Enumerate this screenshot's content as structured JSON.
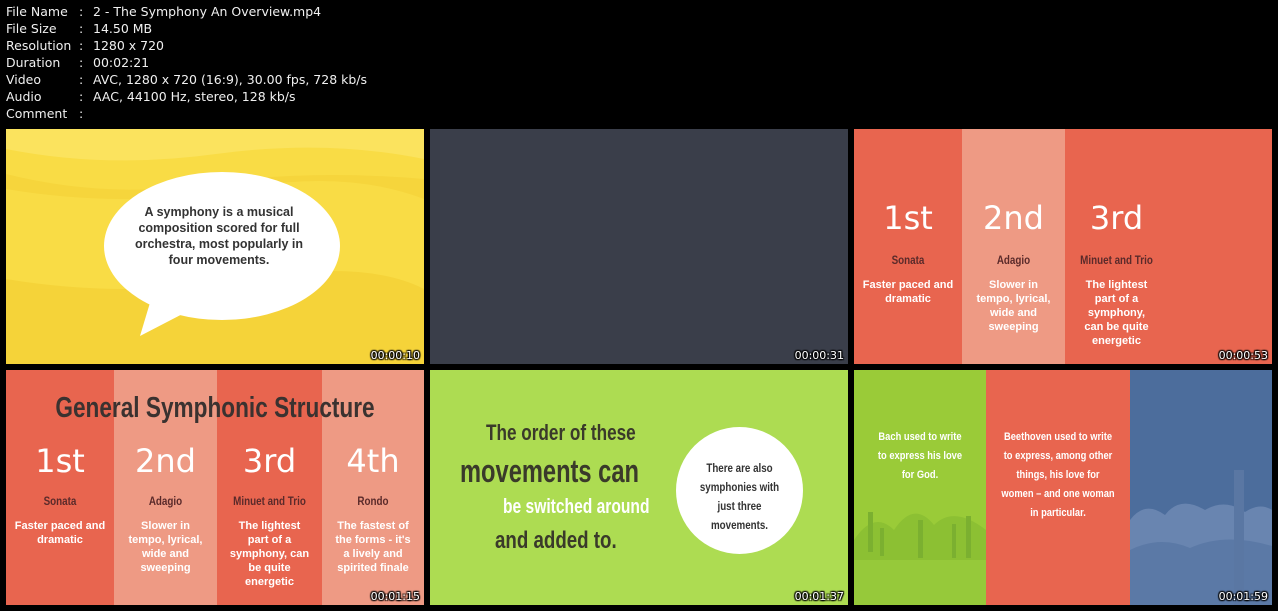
{
  "meta": {
    "rows": [
      {
        "key": "File Name",
        "sep": ":",
        "value": "2 - The Symphony An Overview.mp4"
      },
      {
        "key": "File Size",
        "sep": ":",
        "value": "14.50 MB"
      },
      {
        "key": "Resolution",
        "sep": ":",
        "value": "1280 x 720"
      },
      {
        "key": "Duration",
        "sep": ":",
        "value": "00:02:21"
      },
      {
        "key": "Video",
        "sep": ":",
        "value": "AVC, 1280 x 720 (16:9), 30.00 fps, 728 kb/s"
      },
      {
        "key": "Audio",
        "sep": ":",
        "value": "AAC, 44100 Hz, stereo, 128 kb/s"
      },
      {
        "key": "Comment",
        "sep": ":",
        "value": ""
      }
    ]
  },
  "thumbs": {
    "t1": {
      "timestamp": "00:00:10",
      "bubble_text": "A symphony is a musical composition scored for full orchestra, most popularly in four movements.",
      "bg": "#f9dc45"
    },
    "t2": {
      "timestamp": "00:00:31",
      "bg": "#3a3e4a"
    },
    "t3": {
      "timestamp": "00:00:53",
      "columns": [
        {
          "ord": "1st",
          "name": "Sonata",
          "desc": "Faster paced and dramatic"
        },
        {
          "ord": "2nd",
          "name": "Adagio",
          "desc": "Slower in tempo, lyrical, wide and sweeping"
        },
        {
          "ord": "3rd",
          "name": "Minuet and Trio",
          "desc": "The lightest part of a symphony, can be quite energetic"
        }
      ]
    },
    "t4": {
      "timestamp": "00:01:15",
      "title": "General Symphonic Structure",
      "columns": [
        {
          "ord": "1st",
          "name": "Sonata",
          "desc": "Faster paced and dramatic"
        },
        {
          "ord": "2nd",
          "name": "Adagio",
          "desc": "Slower in tempo, lyrical, wide and sweeping"
        },
        {
          "ord": "3rd",
          "name": "Minuet and Trio",
          "desc": "The lightest part of a symphony, can be quite energetic"
        },
        {
          "ord": "4th",
          "name": "Rondo",
          "desc": "The fastest of the forms - it's a lively and spirited finale"
        }
      ]
    },
    "t5": {
      "timestamp": "00:01:37",
      "lines": [
        "The order of these",
        "movements can",
        "be switched around",
        "and added to."
      ],
      "circle_text": "There are also symphonies with just three movements."
    },
    "t6": {
      "timestamp": "00:01:59",
      "left_text": "Bach used to write to express his love for God.",
      "mid_text": "Beethoven used to write to express, among other things, his love for women – and one woman in particular."
    }
  },
  "colors": {
    "coral": "#e8654f",
    "salmon": "#ee9a84",
    "yellow": "#f9dc45",
    "lime": "#addc52",
    "dark": "#3a3e4a",
    "blue": "#4c6d9c"
  }
}
